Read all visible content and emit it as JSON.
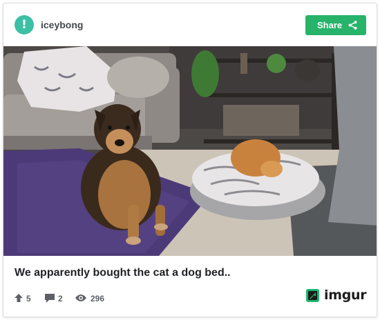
{
  "header": {
    "avatar_glyph": "!",
    "username": "iceybong",
    "share_label": "Share"
  },
  "post": {
    "title": "We apparently bought the cat a dog bed.."
  },
  "stats": {
    "upvotes": "5",
    "comments": "2",
    "views": "296"
  },
  "brand": {
    "name": "imgur"
  },
  "colors": {
    "avatar": "#3cc0a5",
    "share_button": "#27b36a",
    "logo_green": "#1bb76e",
    "text_dark": "#1f2124",
    "text_muted": "#5d6066"
  },
  "icons": {
    "share": "share-nodes-icon",
    "upvote": "arrow-up-icon",
    "comments": "speech-bubble-icon",
    "views": "eye-icon",
    "brand": "imgur-logo-icon"
  }
}
